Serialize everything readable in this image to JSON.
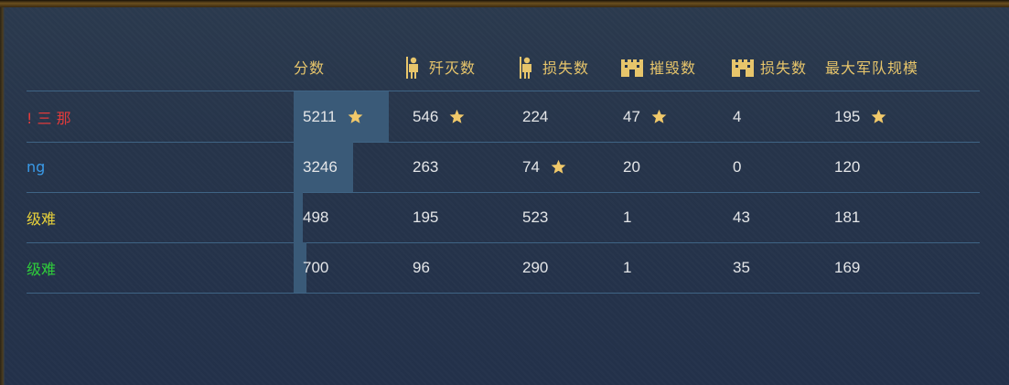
{
  "headers": {
    "score": "分数",
    "kills": "歼灭数",
    "unit_losses": "损失数",
    "destroyed": "摧毁数",
    "building_losses": "损失数",
    "max_army": "最大军队规模"
  },
  "icons": {
    "kills": "soldier-icon",
    "unit_losses": "soldier-icon",
    "destroyed": "castle-icon",
    "building_losses": "castle-icon",
    "best": "star-icon"
  },
  "colors": {
    "header_text": "#e7c56b",
    "score_bar": "#3a5a78",
    "star": "#f1c96a"
  },
  "score_max": 5211,
  "players": [
    {
      "name": "! 三 那",
      "color": "#e23b3b",
      "score": "5211",
      "score_value": 5211,
      "score_star": true,
      "kills": "546",
      "kills_star": true,
      "unit_losses": "224",
      "unit_losses_star": false,
      "destroyed": "47",
      "destroyed_star": true,
      "building_losses": "4",
      "max_army": "195",
      "max_army_star": true
    },
    {
      "name": "ng",
      "color": "#3a9be8",
      "score": "3246",
      "score_value": 3246,
      "score_star": false,
      "kills": "263",
      "kills_star": false,
      "unit_losses": "74",
      "unit_losses_star": true,
      "destroyed": "20",
      "destroyed_star": false,
      "building_losses": "0",
      "max_army": "120",
      "max_army_star": false
    },
    {
      "name": "级难",
      "color": "#e8d23a",
      "score": "498",
      "score_value": 498,
      "score_star": false,
      "kills": "195",
      "kills_star": false,
      "unit_losses": "523",
      "unit_losses_star": false,
      "destroyed": "1",
      "destroyed_star": false,
      "building_losses": "43",
      "max_army": "181",
      "max_army_star": false
    },
    {
      "name": "级难",
      "color": "#2fcf3a",
      "score": "700",
      "score_value": 700,
      "score_star": false,
      "kills": "96",
      "kills_star": false,
      "unit_losses": "290",
      "unit_losses_star": false,
      "destroyed": "1",
      "destroyed_star": false,
      "building_losses": "35",
      "max_army": "169",
      "max_army_star": false
    }
  ]
}
